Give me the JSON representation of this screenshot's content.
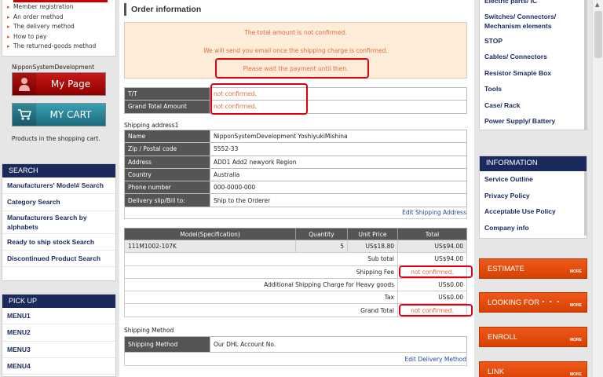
{
  "left": {
    "guide_items": [
      "Member registration",
      "An order method",
      "The delivery method",
      "How to pay",
      "The returned-goods method"
    ],
    "user_name": "NipponSystemDevelopment",
    "mypage_label": "My Page",
    "mycart_label": "MY CART",
    "cart_note": "Products in the shopping cart.",
    "search_title": "SEARCH",
    "search_items": [
      "Manufacturers' Model# Search",
      "Category Search",
      "Manufacturers Search by",
      "alphabets",
      "Ready to ship stock Search",
      "Discontinued Product Search"
    ],
    "pickup_title": "PICK UP",
    "pickup_items": [
      "MENU1",
      "MENU2",
      "MENU3",
      "MENU4"
    ]
  },
  "main": {
    "title": "Order information",
    "notice": {
      "line1": "The total amount is not confirmed.",
      "line2": "We will send you email once the shipping charge is confirmed.",
      "line3": "Please wait the payment until then."
    },
    "payment": [
      {
        "key": "T/T",
        "value": "not confirmed."
      },
      {
        "key": "Grand Total Amount",
        "value": "not confirmed."
      }
    ],
    "shipping_address_title": "Shipping address1",
    "shipping_address": [
      {
        "key": "Name",
        "value": "NipponSystemDevelopment  YoshiyukiMishina"
      },
      {
        "key": "Zip / Postal code",
        "value": "5552-33"
      },
      {
        "key": "Address",
        "value": "ADD1 Add2 newyork Region"
      },
      {
        "key": "Country",
        "value": "Australia"
      },
      {
        "key": "Phone number",
        "value": "000-0000-000"
      },
      {
        "key": "Delivery slip/Bill to:",
        "value": "Ship to the Orderer"
      }
    ],
    "edit_shipping_address": "Edit Shipping Address",
    "order_headers": [
      "Model(Specification)",
      "Quantity",
      "Unit Price",
      "Total"
    ],
    "order_item": {
      "model": "111M1002-107K",
      "qty": "5",
      "unit": "US$18.80",
      "total": "US$94.00"
    },
    "summary": [
      {
        "label": "Sub total",
        "value": "US$94.00"
      },
      {
        "label": "Shipping Fee",
        "value": "not confirmed."
      },
      {
        "label": "Additional Shipping Charge for Heavy goods",
        "value": "US$0.00"
      },
      {
        "label": "Tax",
        "value": "US$0.00"
      },
      {
        "label": "Grand Total",
        "value": "not confirmed."
      }
    ],
    "shipping_method_title": "Shipping Method",
    "shipping_method": {
      "key": "Shipping Method",
      "value": "Our DHL Account No."
    },
    "edit_delivery_method": "Edit Delivery Method"
  },
  "right": {
    "category_items": [
      "Electric parts/ IC",
      "Switches/ Connectors/",
      "Mechanism elements",
      "STOP",
      "Cables/ Connectors",
      "Resistor Smaple Box",
      "Tools",
      "Case/ Rack",
      "Power Supply/ Battery"
    ],
    "info_title": "INFORMATION",
    "info_items": [
      "Service Outline",
      "Privacy Policy",
      "Acceptable Use Policy",
      "Company info"
    ],
    "buttons": [
      "ESTIMATE",
      "LOOKING FOR・・・",
      "ENROLL",
      "LINK"
    ],
    "more_label": "MORE"
  },
  "colors": {
    "accent_red": "#e00010",
    "navy": "#1a2a5c",
    "orange": "#e04c0c",
    "notice_text": "#e26a40"
  }
}
